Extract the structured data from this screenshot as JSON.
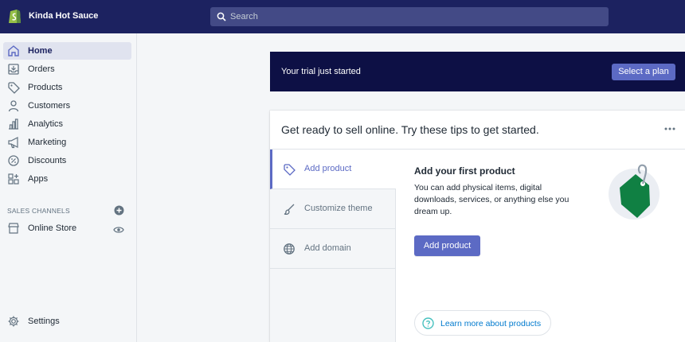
{
  "store": {
    "name": "Kinda Hot Sauce"
  },
  "search": {
    "placeholder": "Search"
  },
  "sidebar": {
    "items": [
      {
        "label": "Home",
        "icon": "home-icon",
        "active": true
      },
      {
        "label": "Orders",
        "icon": "orders-icon"
      },
      {
        "label": "Products",
        "icon": "tag-icon"
      },
      {
        "label": "Customers",
        "icon": "person-icon"
      },
      {
        "label": "Analytics",
        "icon": "bar-chart-icon"
      },
      {
        "label": "Marketing",
        "icon": "megaphone-icon"
      },
      {
        "label": "Discounts",
        "icon": "discount-icon"
      },
      {
        "label": "Apps",
        "icon": "apps-icon"
      }
    ],
    "sales_channels_heading": "SALES CHANNELS",
    "channels": [
      {
        "label": "Online Store",
        "icon": "store-icon"
      }
    ],
    "settings_label": "Settings"
  },
  "trial_banner": {
    "text": "Your trial just started",
    "button": "Select a plan"
  },
  "tips_card": {
    "title": "Get ready to sell online. Try these tips to get started.",
    "tabs": [
      {
        "label": "Add product",
        "icon": "tag-icon",
        "active": true
      },
      {
        "label": "Customize theme",
        "icon": "brush-icon"
      },
      {
        "label": "Add domain",
        "icon": "globe-icon"
      }
    ],
    "detail": {
      "title": "Add your first product",
      "body": "You can add physical items, digital downloads, services, or anything else you dream up.",
      "button": "Add product",
      "learn_more": "Learn more about products"
    }
  },
  "colors": {
    "topbar": "#1c2260",
    "accent": "#5c6ac4",
    "banner": "#0d1045",
    "link": "#007ace",
    "illustration": "#108043"
  }
}
